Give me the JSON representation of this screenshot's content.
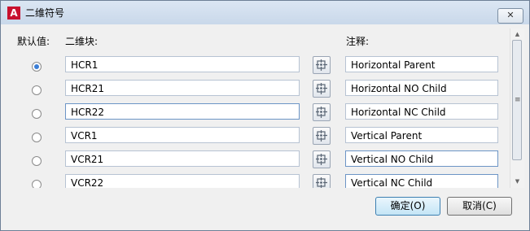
{
  "window": {
    "title": "二维符号",
    "app_icon": "A",
    "close_glyph": "✕"
  },
  "headers": {
    "default": "默认值:",
    "block": "二维块:",
    "note": "注释:"
  },
  "rows": [
    {
      "selected": true,
      "block": "HCR1",
      "note": "Horizontal Parent"
    },
    {
      "selected": false,
      "block": "HCR21",
      "note": "Horizontal NO Child"
    },
    {
      "selected": false,
      "block": "HCR22",
      "note": "Horizontal NC Child"
    },
    {
      "selected": false,
      "block": "VCR1",
      "note": "Vertical Parent"
    },
    {
      "selected": false,
      "block": "VCR21",
      "note": "Vertical NO Child"
    },
    {
      "selected": false,
      "block": "VCR22",
      "note": "Vertical NC Child"
    }
  ],
  "buttons": {
    "ok": "确定(O)",
    "cancel": "取消(C)"
  },
  "scroll": {
    "up": "▲",
    "down": "▼",
    "grip": "≡"
  },
  "icons": {
    "pick": "select-block-icon"
  }
}
